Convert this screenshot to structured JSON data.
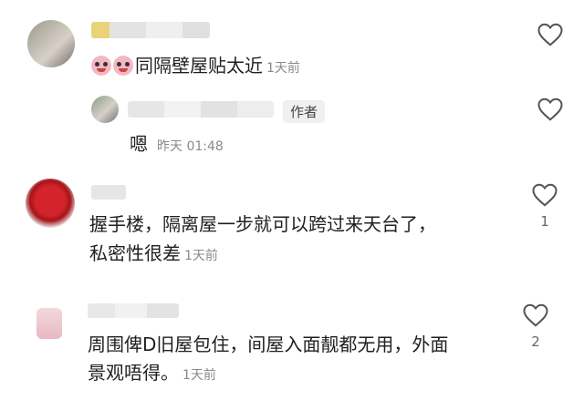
{
  "comments": [
    {
      "text": "同隔壁屋贴太近",
      "time": "1天前",
      "emoji_icons": [
        "crying-emoji-icon",
        "crying-emoji-icon"
      ],
      "like_count": ""
    },
    {
      "reply_text": "嗯",
      "reply_time": "昨天 01:48",
      "author_badge": "作者",
      "like_count": ""
    },
    {
      "line1": "握手楼，隔离屋一步就可以跨过来天台了，",
      "line2": "私密性很差",
      "time": "1天前",
      "like_count": "1"
    },
    {
      "line1": "周围俾D旧屋包住，间屋入面靓都无用，外面",
      "line2": "景观唔得。",
      "time": "1天前",
      "like_count": "2"
    }
  ],
  "colors": {
    "heart_stroke": "#555555",
    "time_gray": "#8a8a8a",
    "badge_bg": "#f0f0f0"
  }
}
